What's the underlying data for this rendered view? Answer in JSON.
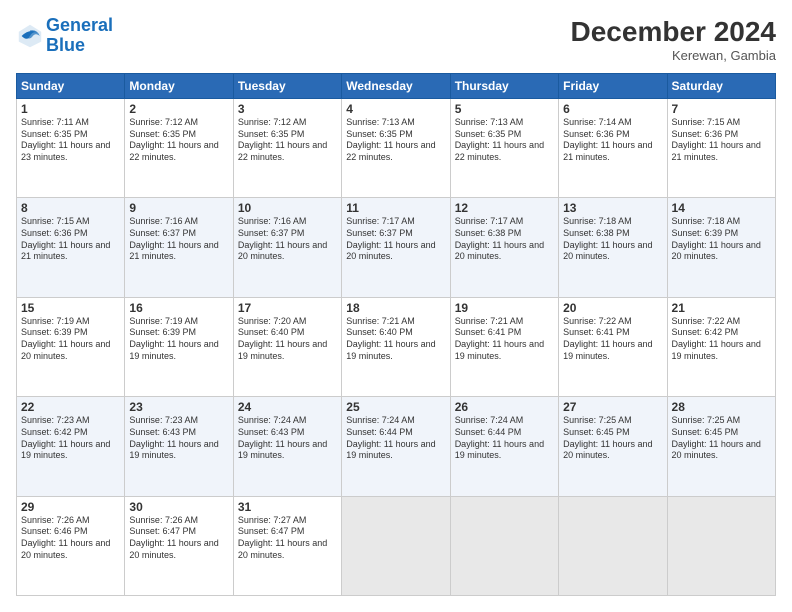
{
  "logo": {
    "line1": "General",
    "line2": "Blue"
  },
  "title": "December 2024",
  "location": "Kerewan, Gambia",
  "days_of_week": [
    "Sunday",
    "Monday",
    "Tuesday",
    "Wednesday",
    "Thursday",
    "Friday",
    "Saturday"
  ],
  "weeks": [
    [
      {
        "day": "1",
        "sunrise": "Sunrise: 7:11 AM",
        "sunset": "Sunset: 6:35 PM",
        "daylight": "Daylight: 11 hours and 23 minutes."
      },
      {
        "day": "2",
        "sunrise": "Sunrise: 7:12 AM",
        "sunset": "Sunset: 6:35 PM",
        "daylight": "Daylight: 11 hours and 22 minutes."
      },
      {
        "day": "3",
        "sunrise": "Sunrise: 7:12 AM",
        "sunset": "Sunset: 6:35 PM",
        "daylight": "Daylight: 11 hours and 22 minutes."
      },
      {
        "day": "4",
        "sunrise": "Sunrise: 7:13 AM",
        "sunset": "Sunset: 6:35 PM",
        "daylight": "Daylight: 11 hours and 22 minutes."
      },
      {
        "day": "5",
        "sunrise": "Sunrise: 7:13 AM",
        "sunset": "Sunset: 6:35 PM",
        "daylight": "Daylight: 11 hours and 22 minutes."
      },
      {
        "day": "6",
        "sunrise": "Sunrise: 7:14 AM",
        "sunset": "Sunset: 6:36 PM",
        "daylight": "Daylight: 11 hours and 21 minutes."
      },
      {
        "day": "7",
        "sunrise": "Sunrise: 7:15 AM",
        "sunset": "Sunset: 6:36 PM",
        "daylight": "Daylight: 11 hours and 21 minutes."
      }
    ],
    [
      {
        "day": "8",
        "sunrise": "Sunrise: 7:15 AM",
        "sunset": "Sunset: 6:36 PM",
        "daylight": "Daylight: 11 hours and 21 minutes."
      },
      {
        "day": "9",
        "sunrise": "Sunrise: 7:16 AM",
        "sunset": "Sunset: 6:37 PM",
        "daylight": "Daylight: 11 hours and 21 minutes."
      },
      {
        "day": "10",
        "sunrise": "Sunrise: 7:16 AM",
        "sunset": "Sunset: 6:37 PM",
        "daylight": "Daylight: 11 hours and 20 minutes."
      },
      {
        "day": "11",
        "sunrise": "Sunrise: 7:17 AM",
        "sunset": "Sunset: 6:37 PM",
        "daylight": "Daylight: 11 hours and 20 minutes."
      },
      {
        "day": "12",
        "sunrise": "Sunrise: 7:17 AM",
        "sunset": "Sunset: 6:38 PM",
        "daylight": "Daylight: 11 hours and 20 minutes."
      },
      {
        "day": "13",
        "sunrise": "Sunrise: 7:18 AM",
        "sunset": "Sunset: 6:38 PM",
        "daylight": "Daylight: 11 hours and 20 minutes."
      },
      {
        "day": "14",
        "sunrise": "Sunrise: 7:18 AM",
        "sunset": "Sunset: 6:39 PM",
        "daylight": "Daylight: 11 hours and 20 minutes."
      }
    ],
    [
      {
        "day": "15",
        "sunrise": "Sunrise: 7:19 AM",
        "sunset": "Sunset: 6:39 PM",
        "daylight": "Daylight: 11 hours and 20 minutes."
      },
      {
        "day": "16",
        "sunrise": "Sunrise: 7:19 AM",
        "sunset": "Sunset: 6:39 PM",
        "daylight": "Daylight: 11 hours and 19 minutes."
      },
      {
        "day": "17",
        "sunrise": "Sunrise: 7:20 AM",
        "sunset": "Sunset: 6:40 PM",
        "daylight": "Daylight: 11 hours and 19 minutes."
      },
      {
        "day": "18",
        "sunrise": "Sunrise: 7:21 AM",
        "sunset": "Sunset: 6:40 PM",
        "daylight": "Daylight: 11 hours and 19 minutes."
      },
      {
        "day": "19",
        "sunrise": "Sunrise: 7:21 AM",
        "sunset": "Sunset: 6:41 PM",
        "daylight": "Daylight: 11 hours and 19 minutes."
      },
      {
        "day": "20",
        "sunrise": "Sunrise: 7:22 AM",
        "sunset": "Sunset: 6:41 PM",
        "daylight": "Daylight: 11 hours and 19 minutes."
      },
      {
        "day": "21",
        "sunrise": "Sunrise: 7:22 AM",
        "sunset": "Sunset: 6:42 PM",
        "daylight": "Daylight: 11 hours and 19 minutes."
      }
    ],
    [
      {
        "day": "22",
        "sunrise": "Sunrise: 7:23 AM",
        "sunset": "Sunset: 6:42 PM",
        "daylight": "Daylight: 11 hours and 19 minutes."
      },
      {
        "day": "23",
        "sunrise": "Sunrise: 7:23 AM",
        "sunset": "Sunset: 6:43 PM",
        "daylight": "Daylight: 11 hours and 19 minutes."
      },
      {
        "day": "24",
        "sunrise": "Sunrise: 7:24 AM",
        "sunset": "Sunset: 6:43 PM",
        "daylight": "Daylight: 11 hours and 19 minutes."
      },
      {
        "day": "25",
        "sunrise": "Sunrise: 7:24 AM",
        "sunset": "Sunset: 6:44 PM",
        "daylight": "Daylight: 11 hours and 19 minutes."
      },
      {
        "day": "26",
        "sunrise": "Sunrise: 7:24 AM",
        "sunset": "Sunset: 6:44 PM",
        "daylight": "Daylight: 11 hours and 19 minutes."
      },
      {
        "day": "27",
        "sunrise": "Sunrise: 7:25 AM",
        "sunset": "Sunset: 6:45 PM",
        "daylight": "Daylight: 11 hours and 20 minutes."
      },
      {
        "day": "28",
        "sunrise": "Sunrise: 7:25 AM",
        "sunset": "Sunset: 6:45 PM",
        "daylight": "Daylight: 11 hours and 20 minutes."
      }
    ],
    [
      {
        "day": "29",
        "sunrise": "Sunrise: 7:26 AM",
        "sunset": "Sunset: 6:46 PM",
        "daylight": "Daylight: 11 hours and 20 minutes."
      },
      {
        "day": "30",
        "sunrise": "Sunrise: 7:26 AM",
        "sunset": "Sunset: 6:47 PM",
        "daylight": "Daylight: 11 hours and 20 minutes."
      },
      {
        "day": "31",
        "sunrise": "Sunrise: 7:27 AM",
        "sunset": "Sunset: 6:47 PM",
        "daylight": "Daylight: 11 hours and 20 minutes."
      },
      null,
      null,
      null,
      null
    ]
  ]
}
